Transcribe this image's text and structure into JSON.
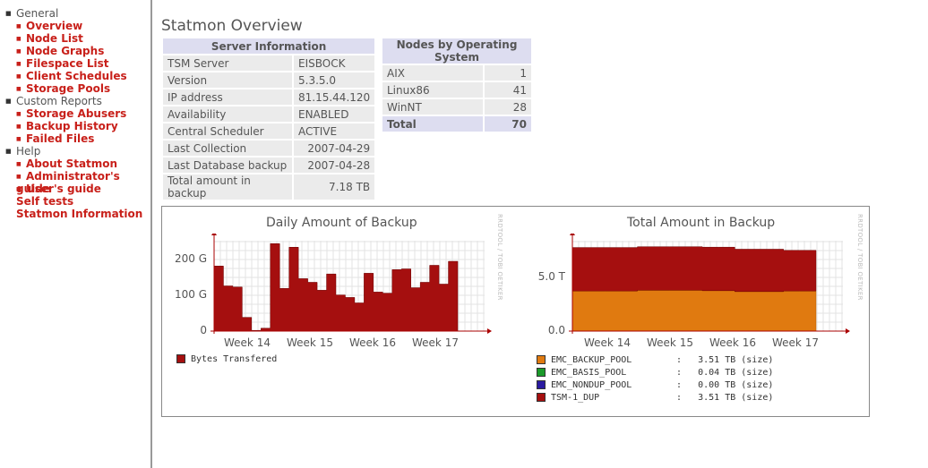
{
  "nav": {
    "general": "General",
    "overview": "Overview",
    "node_list": "Node List",
    "node_graphs": "Node Graphs",
    "filespace_list": "Filespace List",
    "client_schedules": "Client Schedules",
    "storage_pools": "Storage Pools",
    "custom_reports": "Custom Reports",
    "storage_abusers": "Storage Abusers",
    "backup_history": "Backup History",
    "failed_files": "Failed Files",
    "help": "Help",
    "about": "About Statmon",
    "admin_guide": "Administrator's guide",
    "user_guide": "User's guide",
    "self_tests": "Self tests",
    "statmon_info": "Statmon Information"
  },
  "page_title": "Statmon Overview",
  "server_info": {
    "header": "Server Information",
    "rows": [
      {
        "key": "TSM Server",
        "value": "EISBOCK"
      },
      {
        "key": "Version",
        "value": "5.3.5.0"
      },
      {
        "key": "IP address",
        "value": "81.15.44.120"
      },
      {
        "key": "Availability",
        "value": "ENABLED"
      },
      {
        "key": "Central Scheduler",
        "value": "ACTIVE"
      },
      {
        "key": "Last Collection",
        "value": "2007-04-29"
      },
      {
        "key": "Last Database backup",
        "value": "2007-04-28"
      },
      {
        "key": "Total amount in backup",
        "value": "7.18 TB"
      }
    ]
  },
  "nodes_by_os": {
    "header": "Nodes by Operating System",
    "rows": [
      {
        "os": "AIX",
        "count": "1"
      },
      {
        "os": "Linux86",
        "count": "41"
      },
      {
        "os": "WinNT",
        "count": "28"
      }
    ],
    "total_label": "Total",
    "total_value": "70"
  },
  "watermark": "RRDTOOL / TOBI OETIKER",
  "chart_data": [
    {
      "type": "area",
      "title": "Daily Amount of Backup",
      "y_unit": "bytes",
      "yticks": [
        "200 G",
        "100 G",
        "0"
      ],
      "ylim": [
        0,
        250
      ],
      "xticks": [
        "Week 14",
        "Week 15",
        "Week 16",
        "Week 17"
      ],
      "grid": true,
      "legend_position": "bottom-left",
      "series": [
        {
          "name": "Bytes Transfered",
          "color": "#a50f0f",
          "values": [
            180,
            125,
            122,
            38,
            2,
            8,
            242,
            118,
            232,
            145,
            135,
            113,
            158,
            100,
            93,
            78,
            160,
            108,
            105,
            170,
            172,
            120,
            135,
            182,
            130,
            193
          ]
        }
      ]
    },
    {
      "type": "area",
      "title": "Total Amount in Backup",
      "yticks": [
        "5.0 T",
        "0.0"
      ],
      "ylim": [
        0,
        8
      ],
      "xticks": [
        "Week 14",
        "Week 15",
        "Week 16",
        "Week 17"
      ],
      "grid": true,
      "stacked": true,
      "legend_position": "bottom-left",
      "series": [
        {
          "name": "EMC_BACKUP_POOL",
          "color": "#e07a10",
          "summary": "3.51 TB (size)",
          "values": [
            3.55,
            3.55,
            3.55,
            3.55,
            3.62,
            3.62,
            3.62,
            3.62,
            3.58,
            3.58,
            3.5,
            3.5,
            3.5,
            3.55,
            3.55
          ]
        },
        {
          "name": "EMC_BASIS_POOL",
          "color": "#1a9a2a",
          "summary": "0.04 TB (size)",
          "values": [
            0,
            0,
            0,
            0,
            0,
            0,
            0,
            0,
            0,
            0,
            0,
            0,
            0,
            0,
            0
          ]
        },
        {
          "name": "EMC_NONDUP_POOL",
          "color": "#2a1aa0",
          "summary": "0.00 TB (size)",
          "values": [
            0,
            0,
            0,
            0,
            0,
            0,
            0,
            0,
            0,
            0,
            0,
            0,
            0,
            0,
            0
          ]
        },
        {
          "name": "TSM-1_DUP",
          "color": "#a50f0f",
          "summary": "3.51 TB (size)",
          "values": [
            3.85,
            3.85,
            3.85,
            3.85,
            3.85,
            3.85,
            3.85,
            3.85,
            3.85,
            3.85,
            3.75,
            3.75,
            3.75,
            3.6,
            3.6
          ]
        }
      ]
    }
  ]
}
